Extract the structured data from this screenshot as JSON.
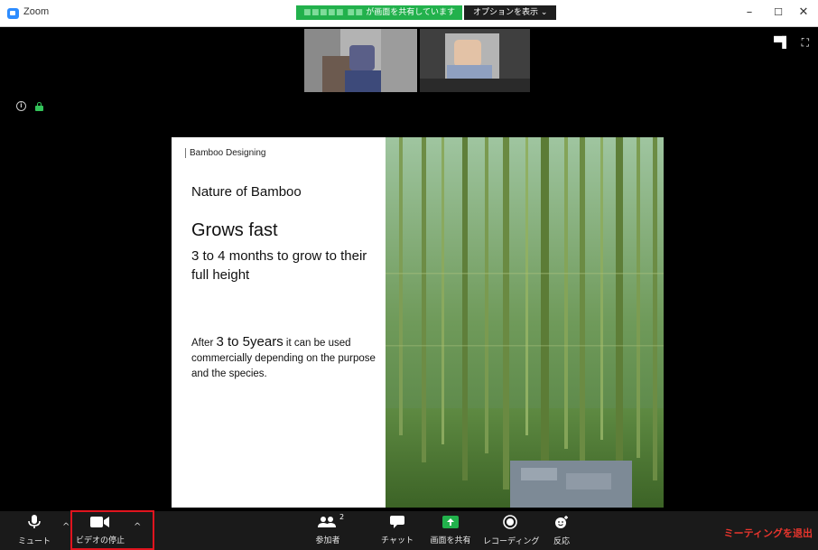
{
  "window": {
    "title": "Zoom",
    "share_status_blurred": "■■■■■ ■■",
    "share_status_text": "が画面を共有しています",
    "options_label": "オプションを表示",
    "minimize": "–",
    "maximize": "☐",
    "close": "✕"
  },
  "slide": {
    "tag": "Bamboo Designing",
    "subtitle": "Nature of Bamboo",
    "heading": "Grows fast",
    "description": "3 to 4 months to grow to their full height",
    "body_prefix": "After ",
    "body_highlight": "3 to 5years",
    "body_suffix": " it can be used commercially depending on the purpose and the species."
  },
  "toolbar": {
    "mute_label": "ミュート",
    "video_label": "ビデオの停止",
    "participants_label": "参加者",
    "participants_count": "2",
    "chat_label": "チャット",
    "share_label": "画面を共有",
    "record_label": "レコーディング",
    "reactions_label": "反応",
    "leave_label": "ミーティングを退出"
  },
  "colors": {
    "share_green": "#22b14c",
    "leave_red": "#e8352d",
    "highlight_red": "#e0141e",
    "toolbar_bg": "#1a1a1a"
  }
}
